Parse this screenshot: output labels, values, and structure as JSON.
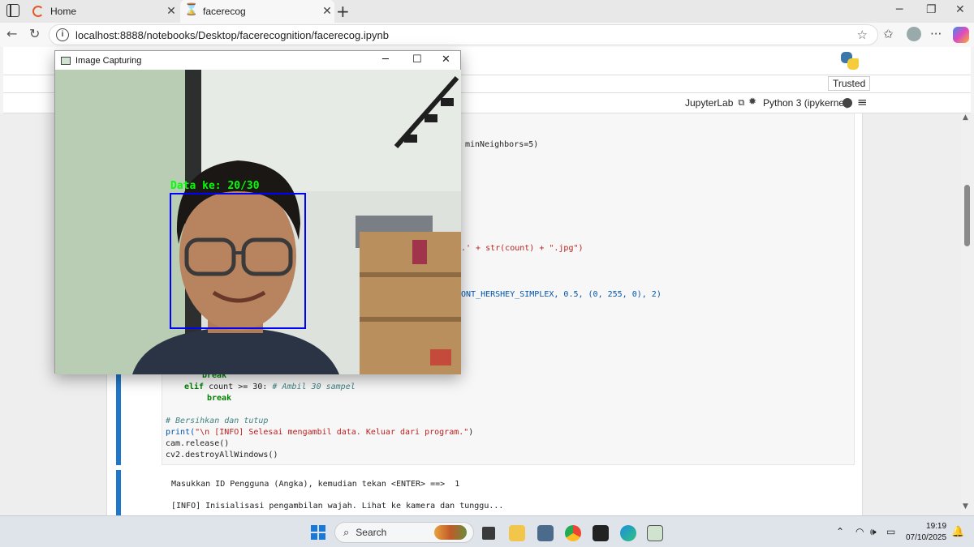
{
  "browser": {
    "tabs": [
      {
        "title": "Home"
      },
      {
        "title": "facerecog"
      }
    ],
    "url": "localhost:8888/notebooks/Desktop/facerecognition/facerecog.ipynb"
  },
  "jupyter": {
    "trusted_label": "Trusted",
    "jupyterlab_label": "JupyterLab",
    "kernel_label": "Python 3 (ipykernel)"
  },
  "notebook": {
    "code_fragments": {
      "min_neighbors": "minNeighbors=5)",
      "imwrite_tail": ".' + str(count) + \".jpg\")",
      "puttext_tail": "ONT_HERSHEY_SIMPLEX, 0.5, (0, 255, 0), 2)"
    },
    "code_lines": {
      "break1": "break",
      "elif_kw": "elif",
      "elif_rest": " count >= 30: ",
      "elif_comment": "# Ambil 30 sampel",
      "break2": "break",
      "comment_cleanup": "# Bersihkan dan tutup",
      "print_fn": "print(",
      "print_str": "\"\\n [INFO] Selesai mengambil data. Keluar dari program.\"",
      "print_close": ")",
      "release": "cam.release()",
      "destroy": "cv2.destroyAllWindows()"
    },
    "output_lines": [
      "Masukkan ID Pengguna (Angka), kemudian tekan <ENTER> ==>  1",
      "[INFO] Inisialisasi pengambilan wajah. Lihat ke kamera dan tunggu..."
    ]
  },
  "opencv_window": {
    "title": "Image Capturing",
    "overlay_text": "Data ke: 20/30"
  },
  "taskbar": {
    "search_placeholder": "Search",
    "time": "19:19",
    "date": "07/10/2025"
  },
  "colors": {
    "accent_blue": "#1f77c9",
    "face_box": "#0000ff",
    "overlay_text": "#00ff00"
  }
}
